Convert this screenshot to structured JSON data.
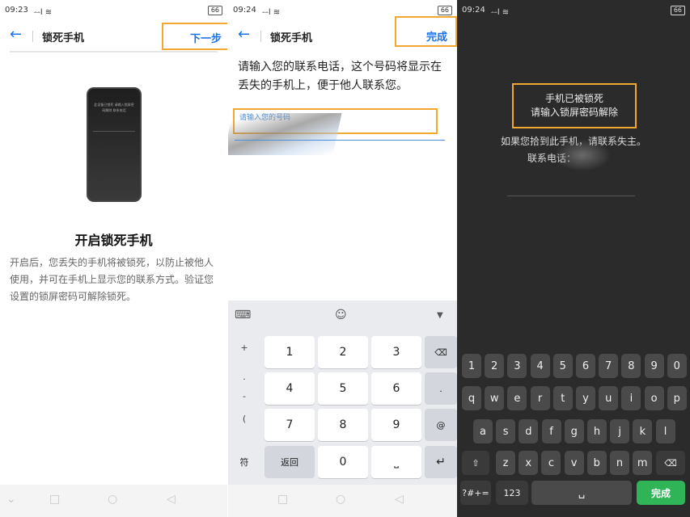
{
  "panel1": {
    "time": "09:23",
    "signal": "⹅⹅l ≋",
    "battery": "66",
    "title": "锁死手机",
    "action": "下一步",
    "phone_screen": "此设备已锁死 请输入锁屏密码解除 联系电话",
    "heading": "开启锁死手机",
    "desc": "开启后，您丢失的手机将被锁死，以防止被他人使用，并可在手机上显示您的联系方式。验证您设置的锁屏密码可解除锁死。"
  },
  "panel2": {
    "time": "09:24",
    "signal": "⹅⹅l ≋",
    "battery": "66",
    "title": "锁死手机",
    "action": "完成",
    "intro": "请输入您的联系电话，这个号码将显示在丢失的手机上，便于他人联系您。",
    "placeholder": "请输入您的号码",
    "numpad": {
      "side": [
        "+",
        ".",
        "-",
        "("
      ],
      "digits": [
        "1",
        "2",
        "3",
        "4",
        "5",
        "6",
        "7",
        "8",
        "9"
      ],
      "symbol": "符",
      "back": "返回",
      "zero": "0",
      "at": "@",
      "dot": "."
    }
  },
  "panel3": {
    "time": "09:24",
    "signal": "⹅⹅l ≋",
    "battery": "66",
    "locked_line1": "手机已被锁死",
    "locked_line2": "请输入锁屏密码解除",
    "found_msg": "如果您拾到此手机，请联系失主。",
    "contact_label": "联系电话：",
    "keyboard": {
      "row1": [
        "1",
        "2",
        "3",
        "4",
        "5",
        "6",
        "7",
        "8",
        "9",
        "0"
      ],
      "row2": [
        "q",
        "w",
        "e",
        "r",
        "t",
        "y",
        "u",
        "i",
        "o",
        "p"
      ],
      "row3": [
        "a",
        "s",
        "d",
        "f",
        "g",
        "h",
        "j",
        "k",
        "l"
      ],
      "row4": [
        "z",
        "x",
        "c",
        "v",
        "b",
        "n",
        "m"
      ],
      "sym_key": "?#+=",
      "num_key": "123",
      "done_key": "完成"
    }
  },
  "colors": {
    "accent": "#1a73e8",
    "highlight": "#f0a830",
    "done_green": "#2fb558"
  }
}
